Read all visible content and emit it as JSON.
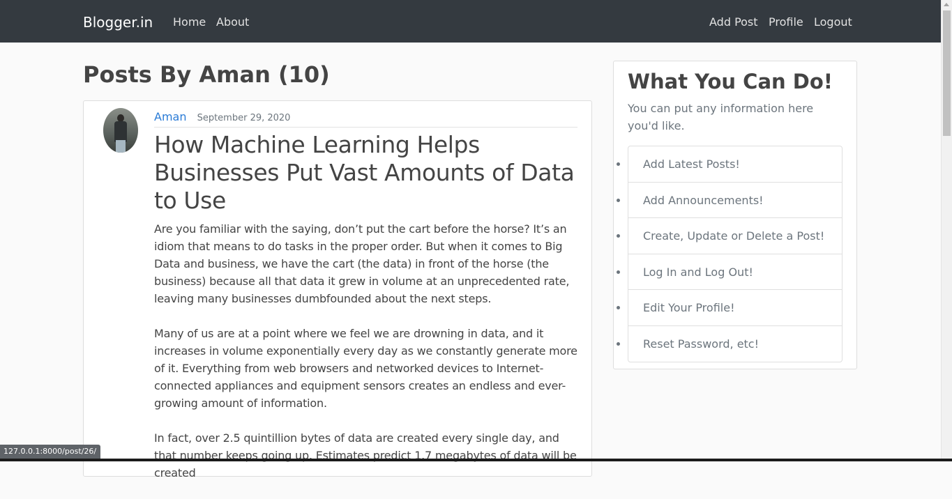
{
  "navbar": {
    "brand": "Blogger.in",
    "left_links": [
      "Home",
      "About"
    ],
    "right_links": [
      "Add Post",
      "Profile",
      "Logout"
    ],
    "background_color": "#343a40"
  },
  "main": {
    "heading": "Posts By Aman (10)",
    "post": {
      "author": "Aman",
      "date": "September 29, 2020",
      "title": "How Machine Learning Helps Businesses Put Vast Amounts of Data to Use",
      "paragraphs": [
        "Are you familiar with the saying, don’t put the cart before the horse? It’s an idiom that means to do tasks in the proper order. But when it comes to Big Data and business, we have the cart (the data) in front of the horse (the business) because all that data it grew in volume at an unprecedented rate, leaving many businesses dumbfounded about the next steps.",
        "Many of us are at a point where we feel we are drowning in data, and it increases in volume exponentially every day as we constantly generate more of it. Everything from web browsers and networked devices to Internet-connected appliances and equipment sensors creates an endless and ever-growing amount of information.",
        "In fact, over 2.5 quintillion bytes of data are created every single day, and that number keeps going up. Estimates predict 1.7 megabytes of data will be created"
      ],
      "author_link_color": "#2a7bd6"
    }
  },
  "sidebar": {
    "title": "What You Can Do!",
    "description": "You can put any information here you'd like.",
    "items": [
      "Add Latest Posts!",
      "Add Announcements!",
      "Create, Update or Delete a Post!",
      "Log In and Log Out!",
      "Edit Your Profile!",
      "Reset Password, etc!"
    ]
  },
  "status_bar": {
    "url": "127.0.0.1:8000/post/26/"
  }
}
